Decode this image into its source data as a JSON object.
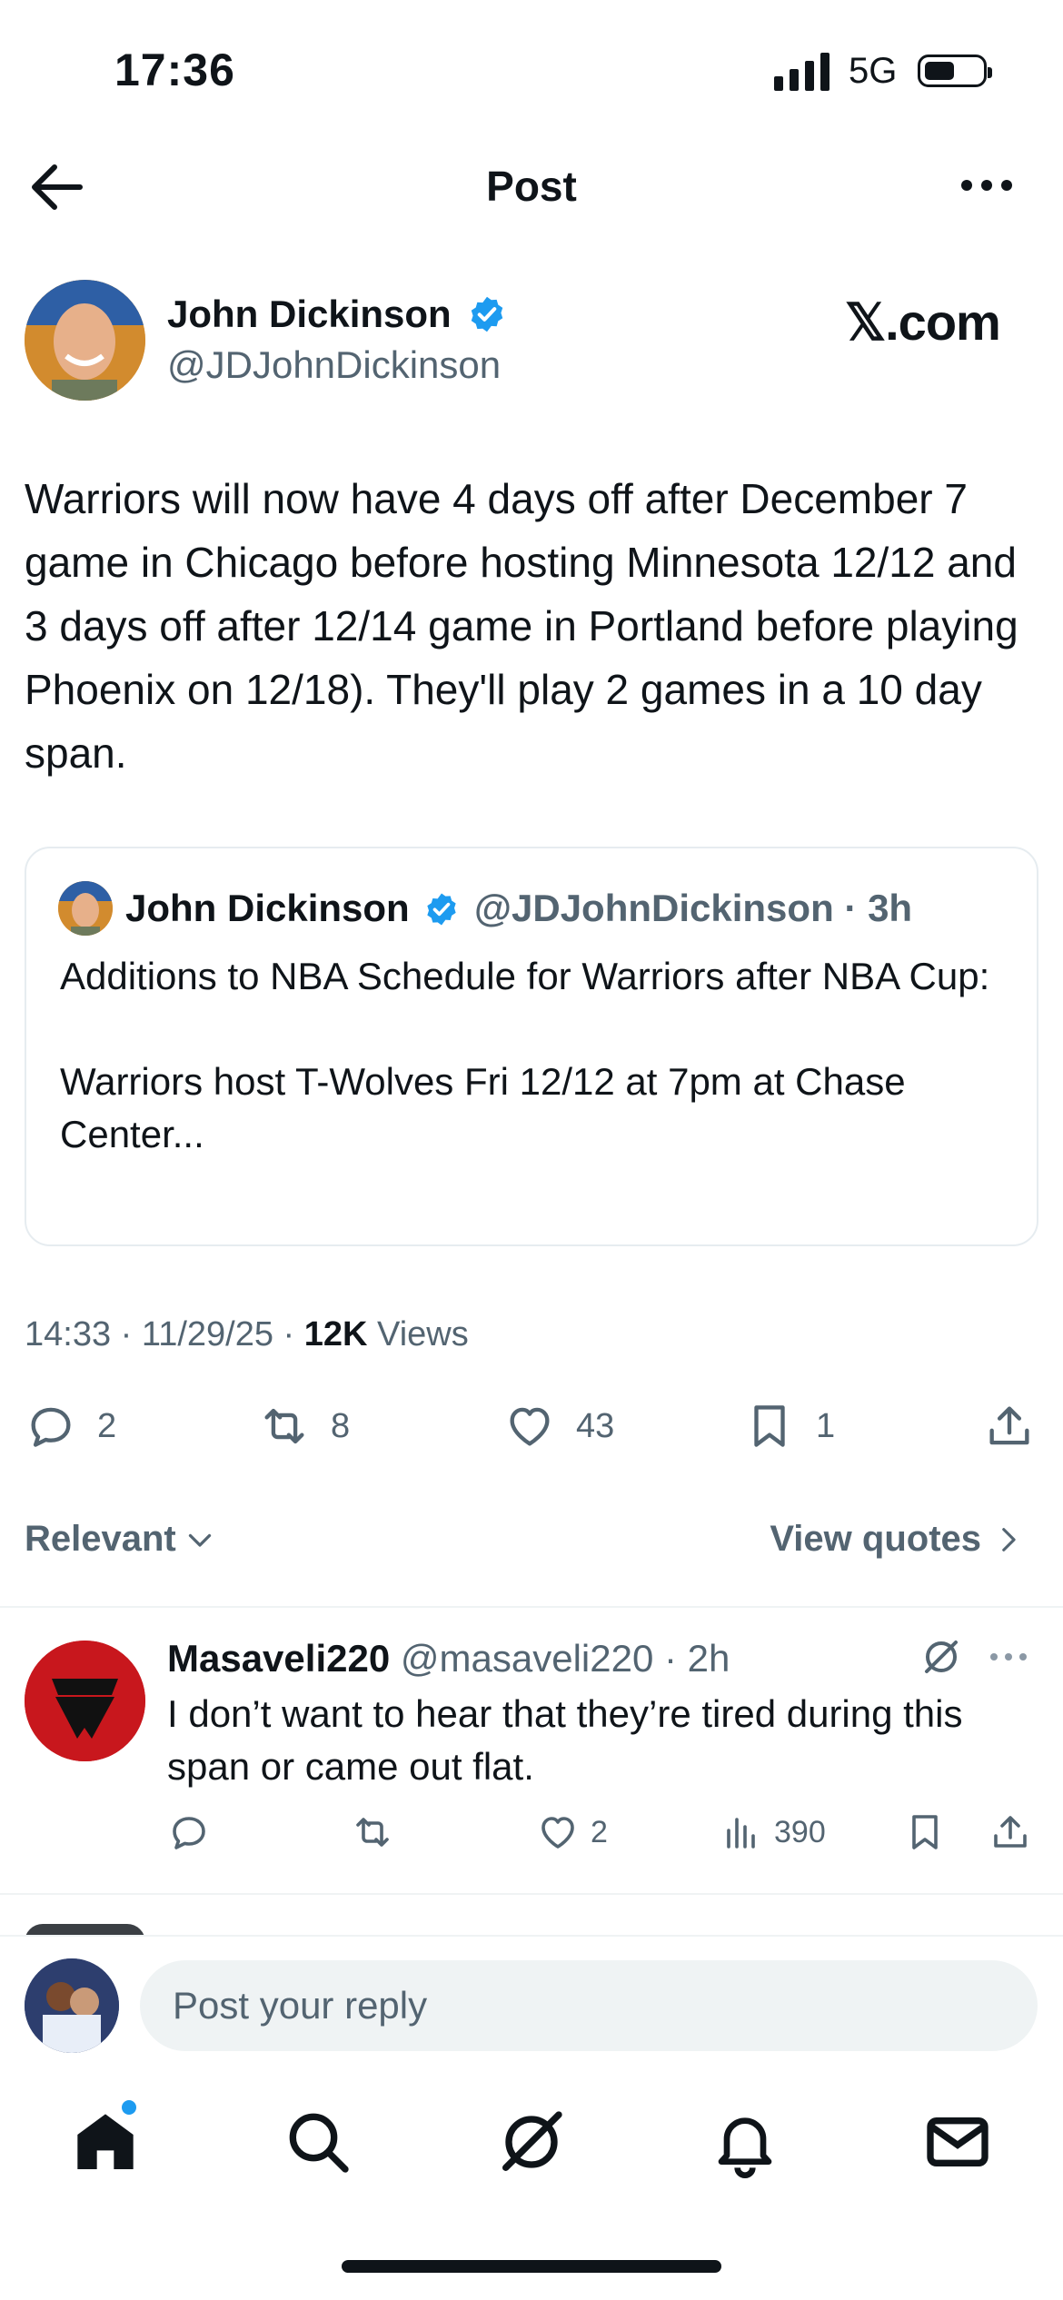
{
  "status_bar": {
    "time": "17:36",
    "network": "5G"
  },
  "header": {
    "title": "Post"
  },
  "post": {
    "author_name": "John Dickinson",
    "author_handle": "@JDJohnDickinson",
    "source": "𝕏.com",
    "text": "Warriors will now have 4 days off after December 7 game in Chicago before hosting Minnesota 12/12 and 3 days off after 12/14 game in Portland before playing Phoenix on 12/18). They'll play 2 games in a 10 day span.",
    "quote": {
      "author_name": "John Dickinson",
      "author_handle": "@JDJohnDickinson",
      "time": "3h",
      "text": "Additions to NBA Schedule for Warriors after NBA Cup:\n\nWarriors host T-Wolves Fri 12/12 at 7pm at Chase Center..."
    },
    "time": "14:33",
    "date": "11/29/25",
    "views_count": "12K",
    "views_label": "Views",
    "replies": "2",
    "reposts": "8",
    "likes": "43",
    "bookmarks": "1"
  },
  "sort": {
    "relevant": "Relevant",
    "view_quotes": "View quotes"
  },
  "reply": {
    "author_name": "Masaveli220",
    "author_handle": "@masaveli220",
    "time": "2h",
    "text": "I don’t want to hear that they’re tired during this span  or came out flat.",
    "likes": "2",
    "views": "390"
  },
  "compose": {
    "placeholder": "Post your reply"
  },
  "colors": {
    "accent": "#1d9bf0",
    "text": "#0f1419",
    "secondary": "#536471"
  }
}
